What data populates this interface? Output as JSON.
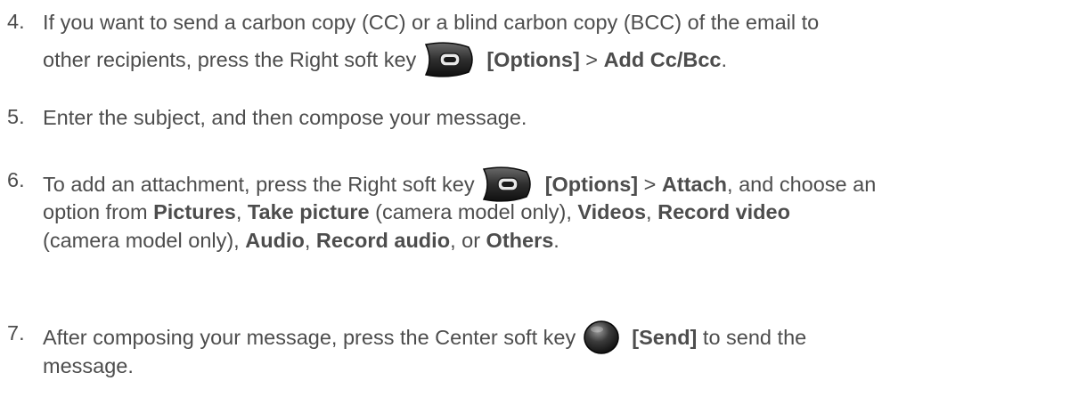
{
  "steps": [
    {
      "number": "4.",
      "line1": "If you want to send a carbon copy (CC) or a blind carbon copy (BCC) of the email to",
      "line2_a": "other recipients, press the Right soft key",
      "line2_b": "[Options]",
      "line2_c": " > ",
      "line2_d": "Add Cc/Bcc",
      "line2_e": "."
    },
    {
      "number": "5.",
      "line1": "Enter the subject, and then compose your message."
    },
    {
      "number": "6.",
      "line1_a": "To add an attachment, press the Right soft key",
      "line1_b": "[Options]",
      "line1_c": " > ",
      "line1_d": "Attach",
      "line1_e": ", and choose an",
      "line2_a": "option from ",
      "line2_b": "Pictures",
      "line2_c": ", ",
      "line2_d": "Take picture",
      "line2_e": " (camera model only), ",
      "line2_f": "Videos",
      "line2_g": ", ",
      "line2_h": "Record video",
      "line3_a": "(camera model only), ",
      "line3_b": "Audio",
      "line3_c": ", ",
      "line3_d": "Record audio",
      "line3_e": ", or ",
      "line3_f": "Others",
      "line3_g": "."
    },
    {
      "number": "7.",
      "line1_a": "After composing your message, press the Center soft key",
      "line1_b": "[Send]",
      "line1_c": " to send the",
      "line2": "message."
    }
  ],
  "icons": {
    "right_soft_key": "right-soft-key-icon",
    "center_soft_key": "center-soft-key-icon"
  }
}
